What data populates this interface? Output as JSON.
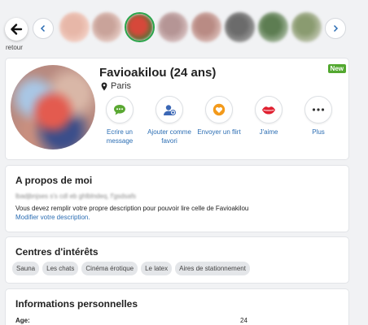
{
  "nav": {
    "back_label": "retour",
    "thumbnails": [
      {
        "colors": [
          "#e7b7a8",
          "#f3d1c6"
        ]
      },
      {
        "colors": [
          "#c9a39a",
          "#e8cfc8"
        ]
      },
      {
        "colors": [
          "#d6483a",
          "#3f7a36"
        ],
        "active": true
      },
      {
        "colors": [
          "#b59595",
          "#d9c3c3"
        ]
      },
      {
        "colors": [
          "#b98b84",
          "#dcbfba"
        ]
      },
      {
        "colors": [
          "#6b6b6b",
          "#9c9c9c"
        ]
      },
      {
        "colors": [
          "#5d7d52",
          "#a9bba2"
        ]
      },
      {
        "colors": [
          "#8a9b70",
          "#c4c9b5"
        ]
      }
    ]
  },
  "profile": {
    "name": "Favioakilou (24 ans)",
    "location": "Paris",
    "badge": "New",
    "actions": [
      {
        "id": "message",
        "label": "Ecrire un message",
        "icon": "chat-icon",
        "color": "#5aa832"
      },
      {
        "id": "favorite",
        "label": "Ajouter comme favori",
        "icon": "add-user-icon",
        "color": "#3b67b5"
      },
      {
        "id": "flirt",
        "label": "Envoyer un flirt",
        "icon": "heart-icon",
        "color": "#f39a1b"
      },
      {
        "id": "like",
        "label": "J'aime",
        "icon": "lips-icon",
        "color": "#e02030"
      },
      {
        "id": "more",
        "label": "Plus",
        "icon": "more-dots-icon",
        "color": "#333333"
      }
    ]
  },
  "about": {
    "title": "A propos de moi",
    "blurred_text": "lbadjbnjses s's cdl eb ghlblndeq, f'gsdsafs",
    "description": "Vous devez remplir votre propre description pour pouvoir lire celle de Favioakilou",
    "link": "Modifier votre description."
  },
  "interests": {
    "title": "Centres d'intérêts",
    "tags": [
      "Sauna",
      "Les chats",
      "Cinéma érotique",
      "Le latex",
      "Aires de stationnement"
    ]
  },
  "info": {
    "title": "Informations personnelles",
    "rows": [
      {
        "label": "Age:",
        "value": "24"
      }
    ]
  }
}
